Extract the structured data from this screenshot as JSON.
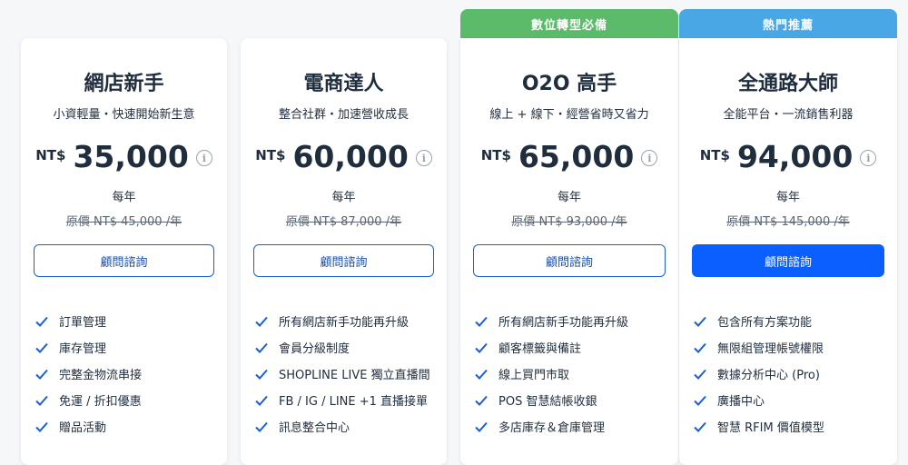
{
  "plans": [
    {
      "title": "網店新手",
      "subtitle": "小資輕量・快速開始新生意",
      "currency": "NT$",
      "price": "35,000",
      "period": "每年",
      "original_price": "原價 NT$ 45,000 /年",
      "cta": "顧問諮詢",
      "features": [
        "訂單管理",
        "庫存管理",
        "完整金物流串接",
        "免運 / 折扣優惠",
        "贈品活動"
      ]
    },
    {
      "title": "電商達人",
      "subtitle": "整合社群・加速營收成長",
      "currency": "NT$",
      "price": "60,000",
      "period": "每年",
      "original_price": "原價 NT$ 87,000 /年",
      "cta": "顧問諮詢",
      "features": [
        "所有網店新手功能再升級",
        "會員分級制度",
        "SHOPLINE LIVE 獨立直播間",
        "FB / IG / LINE +1 直播接單",
        "訊息整合中心"
      ]
    },
    {
      "ribbon": "數位轉型必備",
      "title": "O2O 高手",
      "subtitle": "線上 + 線下・經營省時又省力",
      "currency": "NT$",
      "price": "65,000",
      "period": "每年",
      "original_price": "原價 NT$ 93,000 /年",
      "cta": "顧問諮詢",
      "features": [
        "所有網店新手功能再升級",
        "顧客標籤與備註",
        "線上買門市取",
        "POS 智慧結帳收銀",
        "多店庫存＆倉庫管理"
      ]
    },
    {
      "ribbon": "熱門推薦",
      "title": "全通路大師",
      "subtitle": "全能平台・一流銷售利器",
      "currency": "NT$",
      "price": "94,000",
      "period": "每年",
      "original_price": "原價 NT$ 145,000 /年",
      "cta": "顧問諮詢",
      "features": [
        "包含所有方案功能",
        "無限組管理帳號權限",
        "數據分析中心 (Pro)",
        "廣播中心",
        "智慧 RFIM 價值模型"
      ]
    }
  ],
  "colors": {
    "accent": "#0b5fff",
    "ribbon_green": "#5cbb6a",
    "ribbon_blue": "#4aa7e6",
    "check": "#1a5fd6"
  },
  "icons": {
    "info": "info-circle-icon",
    "check": "check-icon"
  }
}
